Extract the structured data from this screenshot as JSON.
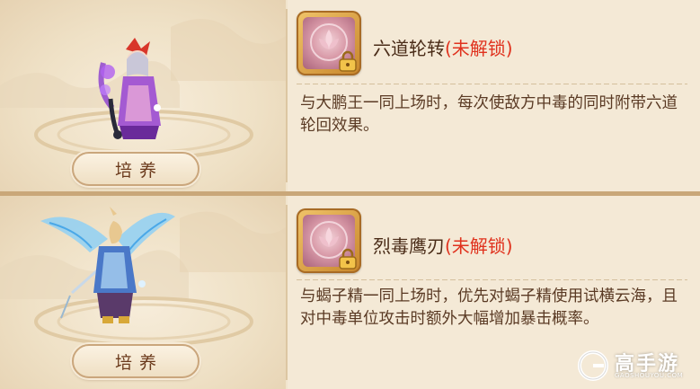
{
  "cards": [
    {
      "train_label": "培养",
      "skill_name": "六道轮转",
      "lock_status": "(未解锁)",
      "description": "与大鹏王一同上场时，每次使敌方中毒的同时附带六道轮回效果。",
      "skill_icon": "lotus-emblem-icon",
      "character": "purple-sorceress"
    },
    {
      "train_label": "培养",
      "skill_name": "烈毒鹰刃",
      "lock_status": "(未解锁)",
      "description": "与蝎子精一同上场时，优先对蝎子精使用试横云海，且对中毒单位攻击时额外大幅增加暴击概率。",
      "skill_icon": "lotus-emblem-icon",
      "character": "blue-winged-warrior"
    }
  ],
  "watermark": {
    "brand": "高手游",
    "domain": "GAOSHOUYOU.COM"
  },
  "colors": {
    "panel_bg": "#f1e4cd",
    "locked_red": "#e0321e",
    "text_brown": "#5a3a24"
  }
}
